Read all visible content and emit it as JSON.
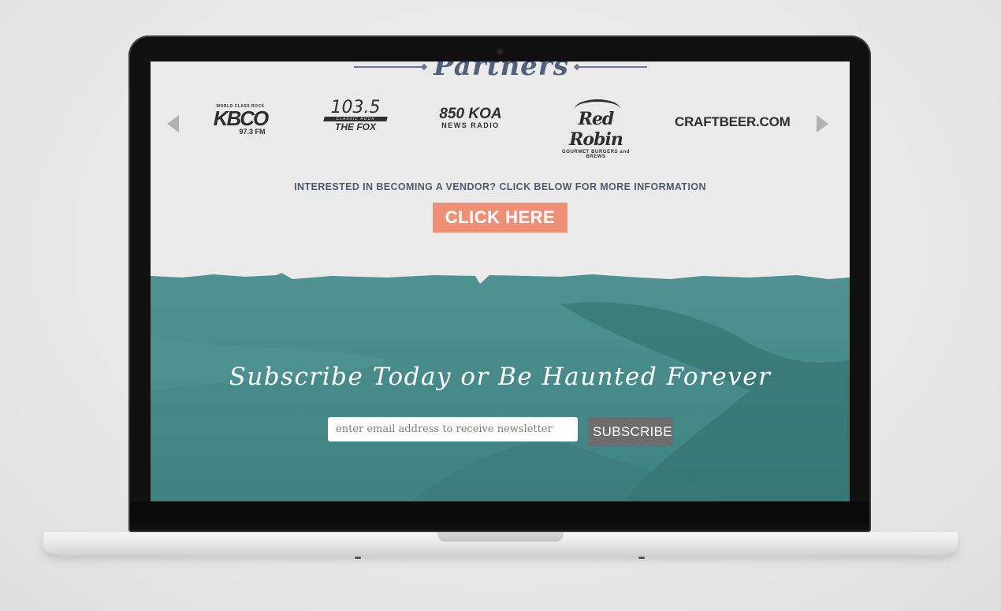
{
  "partners": {
    "title": "Partners",
    "logos": [
      {
        "small": "WORLD CLASS ROCK",
        "name": "KBCO",
        "freq": "97.3 FM"
      },
      {
        "num": "103.5",
        "band": "CLASSIC ROCK",
        "name": "THE FOX"
      },
      {
        "top": "850 KOA",
        "sub": "NEWS RADIO"
      },
      {
        "name": "Red Robin",
        "tag": "GOURMET BURGERS and BREWS"
      },
      {
        "name": "CRAFTBEER.COM"
      }
    ]
  },
  "vendor": {
    "text": "INTERESTED IN BECOMING A VENDOR? CLICK BELOW FOR MORE INFORMATION",
    "button_label": "CLICK HERE"
  },
  "newsletter": {
    "headline": "Subscribe Today or Be Haunted Forever",
    "email_placeholder": "enter email address to receive newsletter",
    "email_value": "",
    "button_label": "SUBSCRIBE"
  },
  "colors": {
    "accent": "#ef9076",
    "teal": "#4c8f8f",
    "heading": "#506078"
  }
}
